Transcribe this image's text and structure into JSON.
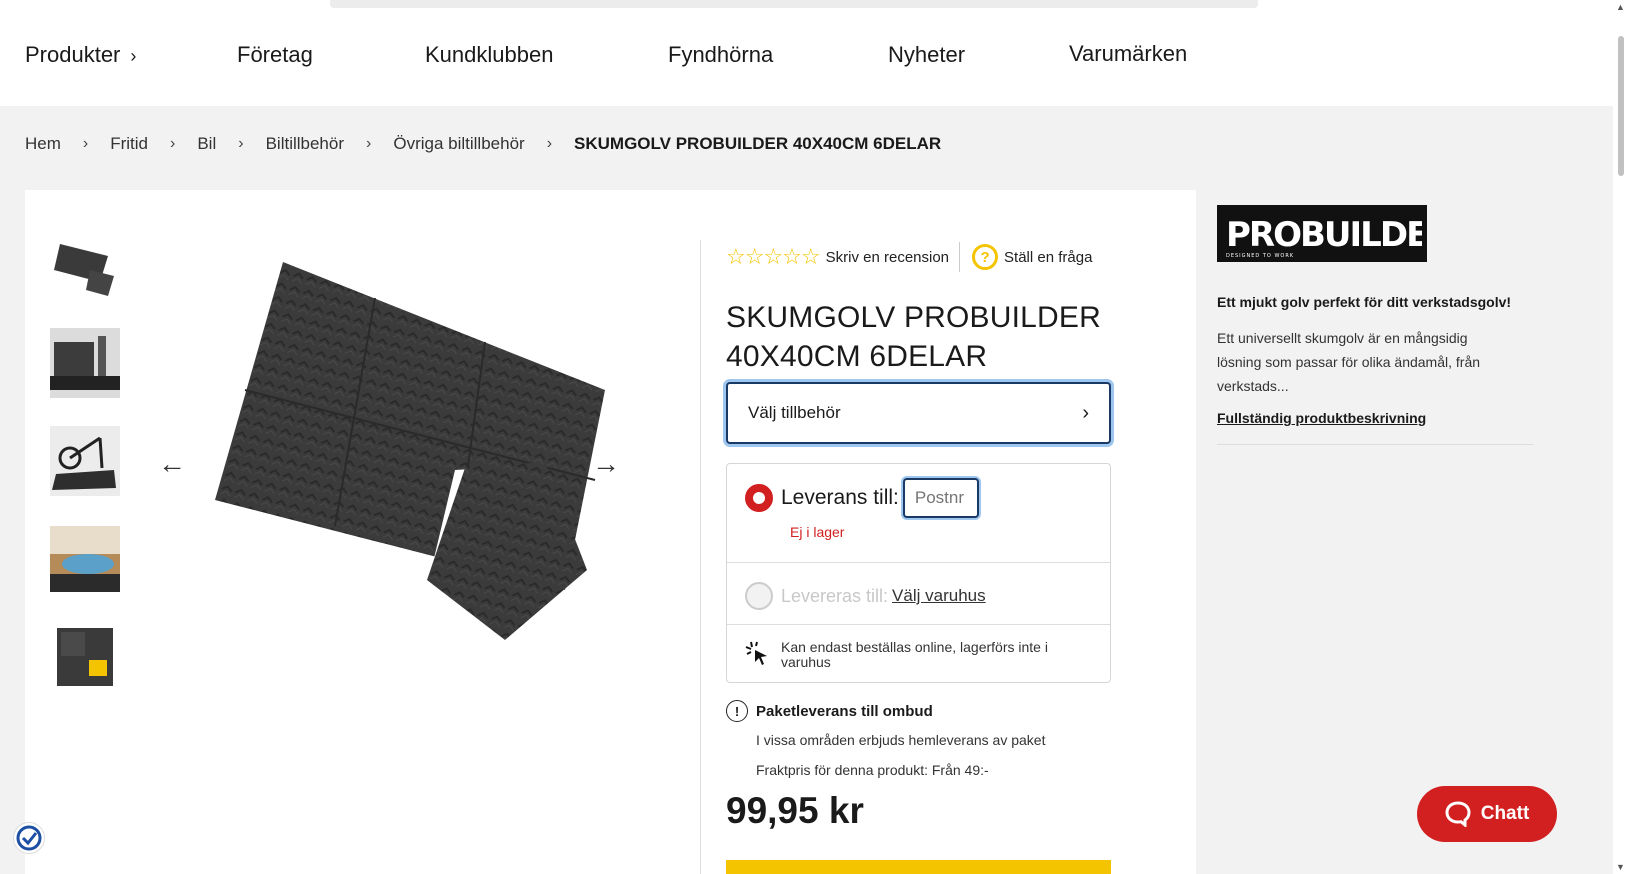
{
  "nav": {
    "items": [
      {
        "label": "Produkter",
        "has_chevron": true
      },
      {
        "label": "Företag"
      },
      {
        "label": "Kundklubben"
      },
      {
        "label": "Fyndhörna"
      },
      {
        "label": "Nyheter"
      },
      {
        "label": "Varumärken"
      }
    ]
  },
  "breadcrumb": [
    "Hem",
    "Fritid",
    "Bil",
    "Biltillbehör",
    "Övriga biltillbehör",
    "SKUMGOLV PROBUILDER 40X40CM 6DELAR"
  ],
  "product": {
    "review_link": "Skriv en recension",
    "question_link": "Ställ en fråga",
    "question_icon_glyph": "?",
    "title_line1": "SKUMGOLV PROBUILDER",
    "title_line2": "40X40CM 6DELAR",
    "accessories_button": "Välj tillbehör",
    "delivery": {
      "delivery_to_label": "Leverans till:",
      "postnr_placeholder": "Postnr",
      "stock_status": "Ej i lager",
      "store_label": "Levereras till:",
      "store_link": "Välj varuhus",
      "online_note": "Kan endast beställas online, lagerförs inte i varuhus"
    },
    "parcel": {
      "heading": "Paketleverans till ombud",
      "line1": "I vissa områden erbjuds hemleverans av paket",
      "line2": "Fraktpris för denna produkt: Från 49:-"
    },
    "price": "99,95 kr"
  },
  "side": {
    "brand_logo_text_main": "PROBUILDER",
    "brand_logo_tagline": "DESIGNED TO WORK",
    "heading": "Ett mjukt golv perfekt för ditt verkstadsgolv!",
    "description": "Ett universellt skumgolv är en mångsidig lösning som passar för olika ändamål, från verkstads...",
    "link": "Fullständig produktbeskrivning"
  },
  "chat": {
    "label": "Chatt"
  },
  "colors": {
    "accent_red": "#d21f1f",
    "accent_yellow": "#f5c400",
    "focus_blue": "#1a3a66"
  },
  "icons": [
    "chevron-right-icon",
    "star-outline-icon",
    "question-circle-icon",
    "arrow-left-icon",
    "arrow-right-icon",
    "click-cursor-icon",
    "exclamation-circle-icon",
    "chat-bubble-icon",
    "trust-check-icon"
  ]
}
